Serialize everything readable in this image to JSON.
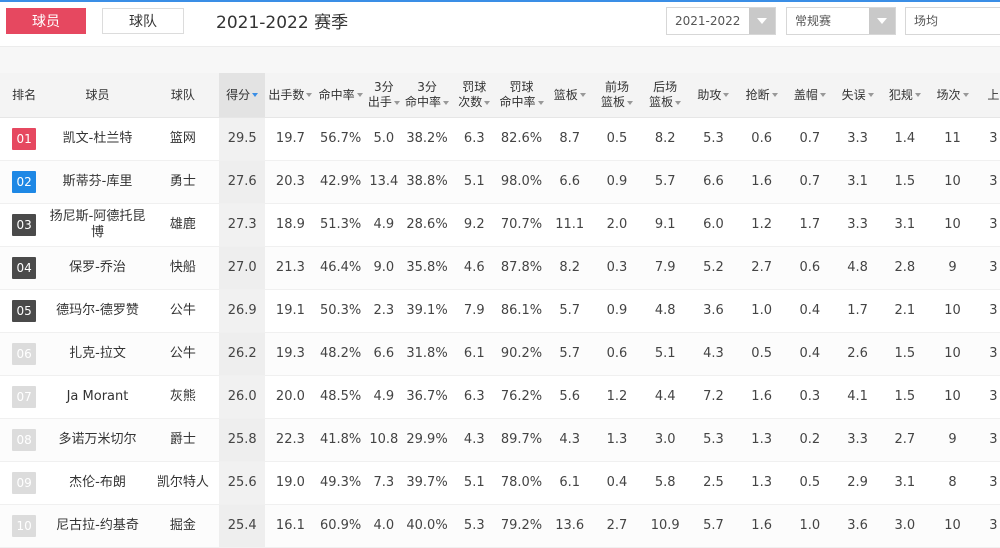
{
  "top": {
    "tab_player": "球员",
    "tab_team": "球队",
    "season_title": "2021-2022 赛季",
    "select_season": "2021-2022",
    "select_type": "常规赛",
    "select_venue": "场均"
  },
  "colors": {
    "rank_top": "#e64860",
    "rank_2": "#1e88e5",
    "rank_mid": "#4a4a4a",
    "rank_low": "#dcdcdc"
  },
  "headers": [
    {
      "label": "排名",
      "sort": false
    },
    {
      "label": "球员",
      "sort": false
    },
    {
      "label": "球队",
      "sort": false
    },
    {
      "label": "得分",
      "sort": true
    },
    {
      "label": "出手数",
      "sort": true
    },
    {
      "label": "命中率",
      "sort": true
    },
    {
      "label": "3分\n出手",
      "sort": true
    },
    {
      "label": "3分\n命中率",
      "sort": true
    },
    {
      "label": "罚球\n次数",
      "sort": true
    },
    {
      "label": "罚球\n命中率",
      "sort": true
    },
    {
      "label": "篮板",
      "sort": true
    },
    {
      "label": "前场\n篮板",
      "sort": true
    },
    {
      "label": "后场\n篮板",
      "sort": true
    },
    {
      "label": "助攻",
      "sort": true
    },
    {
      "label": "抢断",
      "sort": true
    },
    {
      "label": "盖帽",
      "sort": true
    },
    {
      "label": "失误",
      "sort": true
    },
    {
      "label": "犯规",
      "sort": true
    },
    {
      "label": "场次",
      "sort": true
    },
    {
      "label": "上",
      "sort": false
    }
  ],
  "rows": [
    {
      "rank": "01",
      "player": "凯文-杜兰特",
      "team": "篮网",
      "stats": [
        "29.5",
        "19.7",
        "56.7%",
        "5.0",
        "38.2%",
        "6.3",
        "82.6%",
        "8.7",
        "0.5",
        "8.2",
        "5.3",
        "0.6",
        "0.7",
        "3.3",
        "1.4",
        "11",
        "3"
      ]
    },
    {
      "rank": "02",
      "player": "斯蒂芬-库里",
      "team": "勇士",
      "stats": [
        "27.6",
        "20.3",
        "42.9%",
        "13.4",
        "38.8%",
        "5.1",
        "98.0%",
        "6.6",
        "0.9",
        "5.7",
        "6.6",
        "1.6",
        "0.7",
        "3.1",
        "1.5",
        "10",
        "3"
      ]
    },
    {
      "rank": "03",
      "player": "扬尼斯-阿德托昆博",
      "team": "雄鹿",
      "stats": [
        "27.3",
        "18.9",
        "51.3%",
        "4.9",
        "28.6%",
        "9.2",
        "70.7%",
        "11.1",
        "2.0",
        "9.1",
        "6.0",
        "1.2",
        "1.7",
        "3.3",
        "3.1",
        "10",
        "3"
      ]
    },
    {
      "rank": "04",
      "player": "保罗-乔治",
      "team": "快船",
      "stats": [
        "27.0",
        "21.3",
        "46.4%",
        "9.0",
        "35.8%",
        "4.6",
        "87.8%",
        "8.2",
        "0.3",
        "7.9",
        "5.2",
        "2.7",
        "0.6",
        "4.8",
        "2.8",
        "9",
        "3"
      ]
    },
    {
      "rank": "05",
      "player": "德玛尔-德罗赞",
      "team": "公牛",
      "stats": [
        "26.9",
        "19.1",
        "50.3%",
        "2.3",
        "39.1%",
        "7.9",
        "86.1%",
        "5.7",
        "0.9",
        "4.8",
        "3.6",
        "1.0",
        "0.4",
        "1.7",
        "2.1",
        "10",
        "3"
      ]
    },
    {
      "rank": "06",
      "player": "扎克-拉文",
      "team": "公牛",
      "stats": [
        "26.2",
        "19.3",
        "48.2%",
        "6.6",
        "31.8%",
        "6.1",
        "90.2%",
        "5.7",
        "0.6",
        "5.1",
        "4.3",
        "0.5",
        "0.4",
        "2.6",
        "1.5",
        "10",
        "3"
      ]
    },
    {
      "rank": "07",
      "player": "Ja Morant",
      "team": "灰熊",
      "stats": [
        "26.0",
        "20.0",
        "48.5%",
        "4.9",
        "36.7%",
        "6.3",
        "76.2%",
        "5.6",
        "1.2",
        "4.4",
        "7.2",
        "1.6",
        "0.3",
        "4.1",
        "1.5",
        "10",
        "3"
      ]
    },
    {
      "rank": "08",
      "player": "多诺万米切尔",
      "team": "爵士",
      "stats": [
        "25.8",
        "22.3",
        "41.8%",
        "10.8",
        "29.9%",
        "4.3",
        "89.7%",
        "4.3",
        "1.3",
        "3.0",
        "5.3",
        "1.3",
        "0.2",
        "3.3",
        "2.7",
        "9",
        "3"
      ]
    },
    {
      "rank": "09",
      "player": "杰伦-布朗",
      "team": "凯尔特人",
      "stats": [
        "25.6",
        "19.0",
        "49.3%",
        "7.3",
        "39.7%",
        "5.1",
        "78.0%",
        "6.1",
        "0.4",
        "5.8",
        "2.5",
        "1.3",
        "0.5",
        "2.9",
        "3.1",
        "8",
        "3"
      ]
    },
    {
      "rank": "10",
      "player": "尼古拉-约基奇",
      "team": "掘金",
      "stats": [
        "25.4",
        "16.1",
        "60.9%",
        "4.0",
        "40.0%",
        "5.3",
        "79.2%",
        "13.6",
        "2.7",
        "10.9",
        "5.7",
        "1.6",
        "1.0",
        "3.6",
        "3.0",
        "10",
        "3"
      ]
    }
  ]
}
